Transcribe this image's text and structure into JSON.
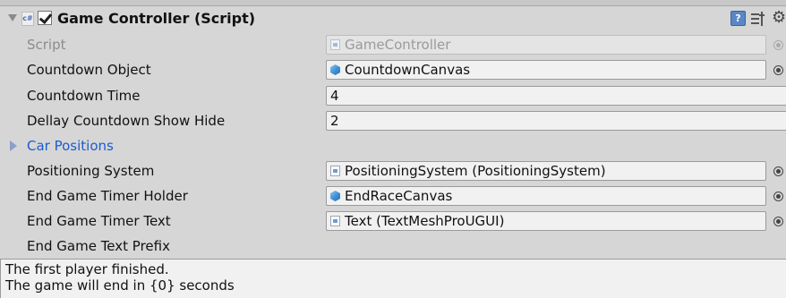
{
  "component": {
    "title": "Game Controller (Script)",
    "enabled": true,
    "script_icon_label": "c#",
    "help_icon_label": "?"
  },
  "fields": {
    "script": {
      "label": "Script",
      "value": "GameController"
    },
    "countdown_object": {
      "label": "Countdown Object",
      "value": "CountdownCanvas"
    },
    "countdown_time": {
      "label": "Countdown Time",
      "value": "4"
    },
    "dellay_countdown": {
      "label": "Dellay Countdown Show Hide",
      "value": "2"
    },
    "car_positions": {
      "label": "Car Positions",
      "expanded": false
    },
    "positioning_system": {
      "label": "Positioning System",
      "value": "PositioningSystem (PositioningSystem)"
    },
    "end_game_timer_holder": {
      "label": "End Game Timer Holder",
      "value": "EndRaceCanvas"
    },
    "end_game_timer_text": {
      "label": "End Game Timer Text",
      "value": "Text (TextMeshProUGUI)"
    },
    "end_game_text_prefix": {
      "label": "End Game Text Prefix",
      "lines": [
        "The first player finished.",
        "The game will end in {0} seconds"
      ]
    }
  },
  "icons": {
    "gear": "⚙",
    "cube_color": "#3f8ed6",
    "link_color": "#1c5bd1"
  }
}
